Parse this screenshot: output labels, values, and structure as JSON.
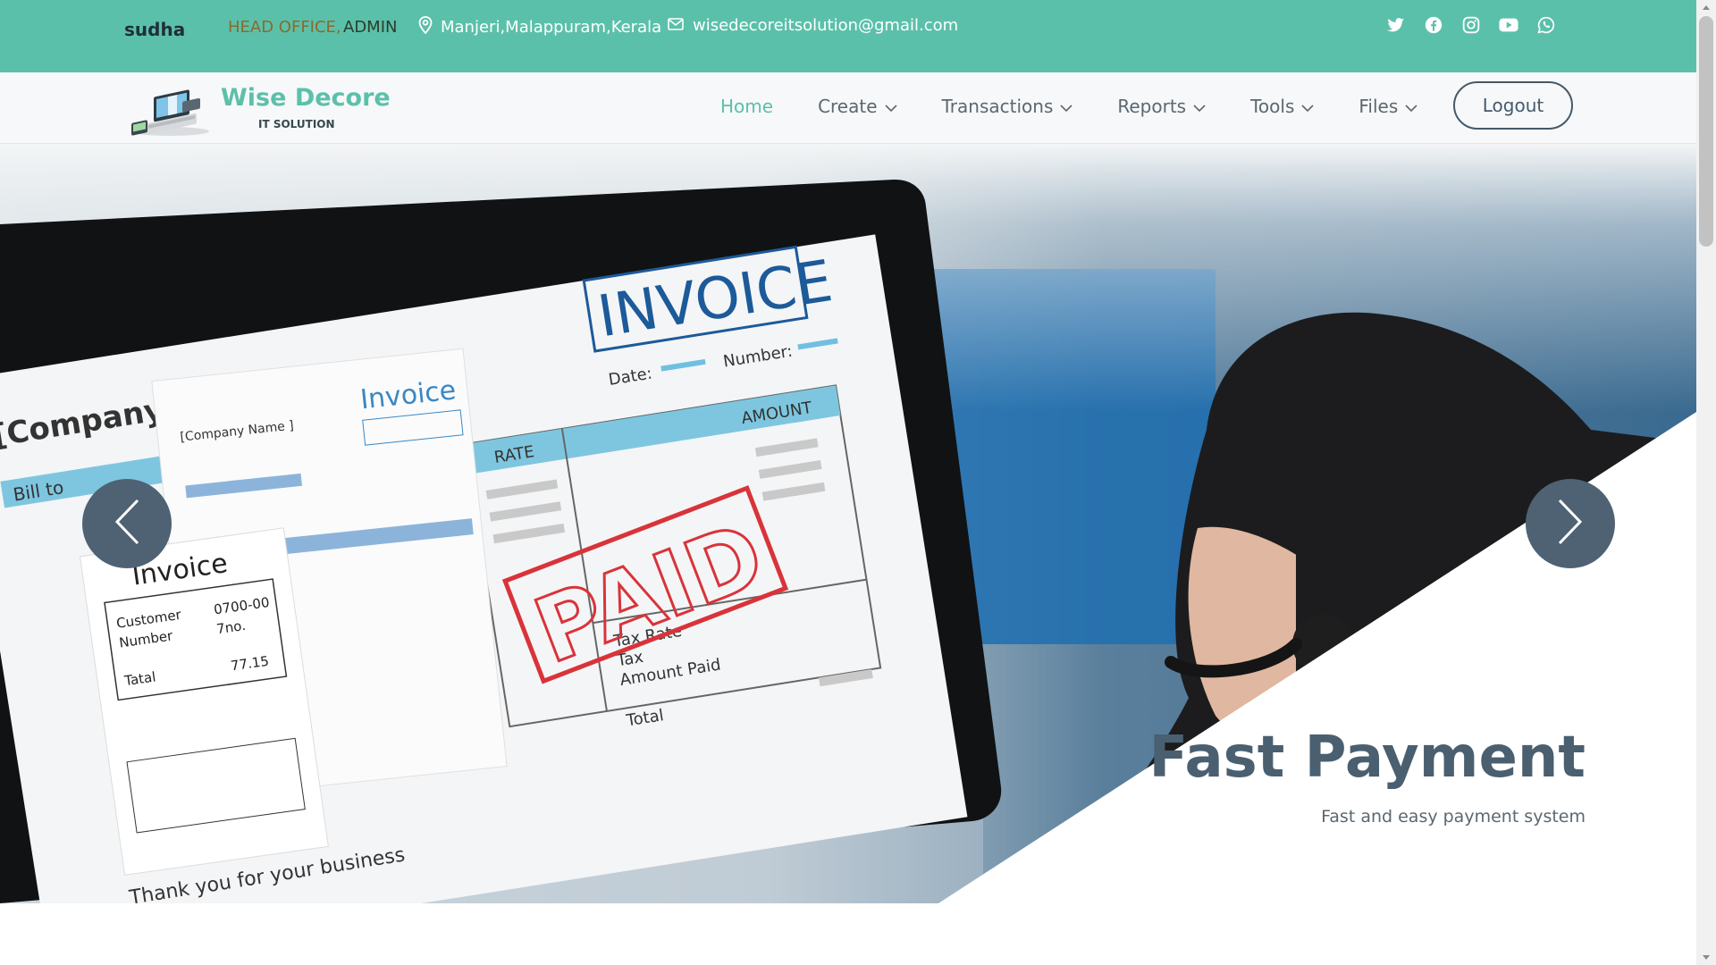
{
  "topbar": {
    "user": "sudha",
    "office": "HEAD OFFICE,",
    "role": "ADMIN",
    "location": "Manjeri,Malappuram,Kerala",
    "email": "wisedecoreitsolution@gmail.com",
    "social_icons": [
      "twitter-icon",
      "facebook-icon",
      "instagram-icon",
      "youtube-icon",
      "whatsapp-icon"
    ],
    "background": "#5bc0aa"
  },
  "brand": {
    "name": "Wise Decore",
    "tagline": "IT SOLUTION",
    "color": "#5bc0aa"
  },
  "nav": {
    "items": [
      {
        "label": "Home",
        "active": true
      },
      {
        "label": "Create"
      },
      {
        "label": "Transactions"
      },
      {
        "label": "Reports"
      },
      {
        "label": "Tools"
      },
      {
        "label": "Files"
      }
    ],
    "logout_label": "Logout"
  },
  "hero": {
    "title": "Fast Payment",
    "subtitle": "Fast and easy payment system",
    "image_text": {
      "invoice_big": "INVOICE",
      "company": "[Company Name ]",
      "invoice_small": "Invoice",
      "company_small": "[Company Name ]",
      "date": "Date:",
      "number": "Number:",
      "bill_to": "Bill to",
      "rate": "RATE",
      "amount": "AMOUNT",
      "paid": "PAID",
      "tax_rate": "Tax Rate",
      "tax": "Tax",
      "amount_paid": "Amount Paid",
      "total": "Total",
      "thank_you": "Thank you for your business",
      "receipt_title": "Invoice",
      "customer": "Customer",
      "customer_number": "Number",
      "customer_value": "0700-00",
      "number_value": "7no.",
      "tatal": "Tatal",
      "tatal_value": "77.15"
    }
  }
}
